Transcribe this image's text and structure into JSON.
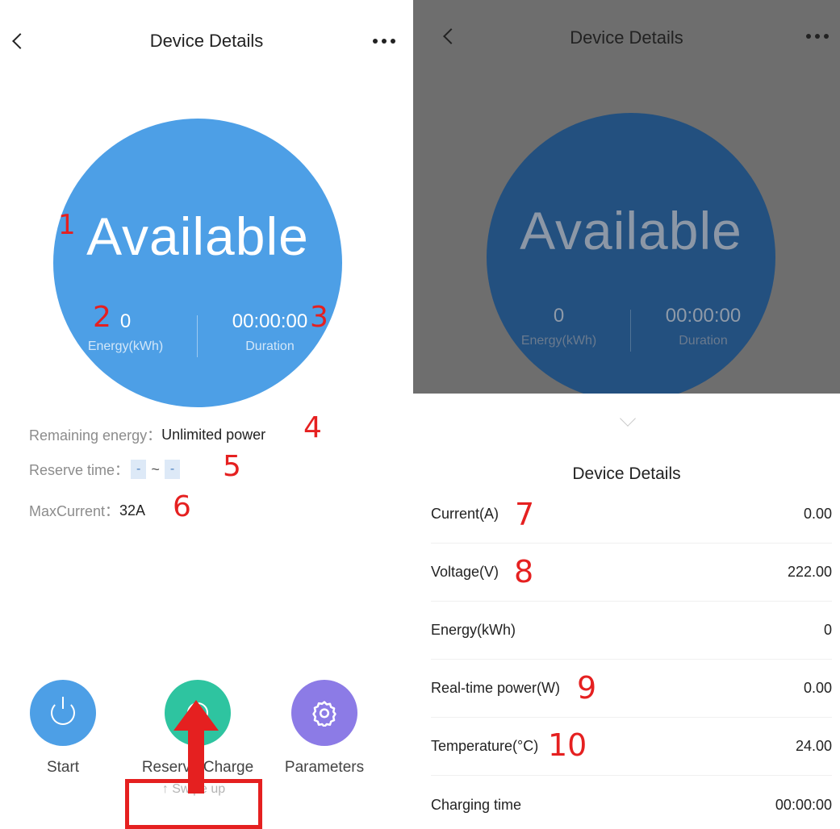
{
  "left": {
    "header": {
      "title": "Device Details"
    },
    "status": {
      "text": "Available",
      "energy_value": "0",
      "energy_label": "Energy(kWh)",
      "duration_value": "00:00:00",
      "duration_label": "Duration"
    },
    "info": {
      "remaining_label": "Remaining energy：",
      "remaining_value": "Unlimited power",
      "reserve_label": "Reserve time：",
      "reserve_start": "-",
      "reserve_tilde": "~",
      "reserve_end": "-",
      "max_current_label": "MaxCurrent：",
      "max_current_value": "32A"
    },
    "actions": [
      {
        "label": "Start",
        "icon": "power-icon",
        "color": "#4d9fe6"
      },
      {
        "label": "Reserve Charge",
        "icon": "ring-icon",
        "color": "#2ec4a0"
      },
      {
        "label": "Parameters",
        "icon": "gear-icon",
        "color": "#8c7be6"
      }
    ],
    "swipe_hint": "↑ Swipe up"
  },
  "right": {
    "header": {
      "title": "Device Details"
    },
    "status": {
      "text": "Available",
      "energy_value": "0",
      "energy_label": "Energy(kWh)",
      "duration_value": "00:00:00",
      "duration_label": "Duration"
    },
    "sheet": {
      "title": "Device Details",
      "rows": [
        {
          "label": "Current(A)",
          "value": "0.00"
        },
        {
          "label": "Voltage(V)",
          "value": "222.00"
        },
        {
          "label": "Energy(kWh)",
          "value": "0"
        },
        {
          "label": "Real-time power(W)",
          "value": "0.00"
        },
        {
          "label": "Temperature(°C)",
          "value": "24.00"
        },
        {
          "label": "Charging time",
          "value": "00:00:00"
        }
      ]
    }
  },
  "annotations": [
    "1",
    "2",
    "3",
    "4",
    "5",
    "6",
    "7",
    "8",
    "9",
    "10"
  ],
  "colors": {
    "accent_blue": "#4d9fe6",
    "accent_green": "#2ec4a0",
    "accent_purple": "#8c7be6",
    "annotation_red": "#e52020"
  }
}
